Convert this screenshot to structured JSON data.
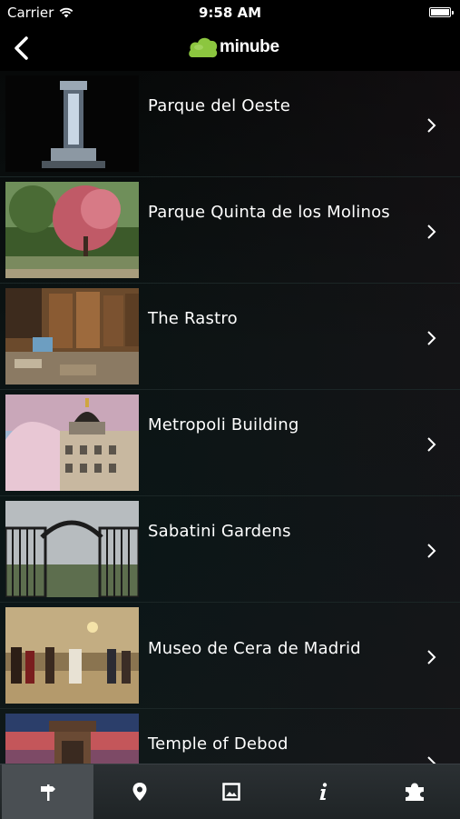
{
  "status_bar": {
    "carrier": "Carrier",
    "time": "9:58 AM"
  },
  "nav": {
    "logo_text": "minube"
  },
  "places": [
    {
      "title": "Parque del Oeste"
    },
    {
      "title": "Parque Quinta de los Molinos"
    },
    {
      "title": "The Rastro"
    },
    {
      "title": "Metropoli Building"
    },
    {
      "title": "Sabatini Gardens"
    },
    {
      "title": "Museo de Cera de Madrid"
    },
    {
      "title": "Temple of Debod"
    }
  ],
  "tabs": [
    {
      "icon": "signpost-icon",
      "active": true
    },
    {
      "icon": "map-pin-icon",
      "active": false
    },
    {
      "icon": "photo-icon",
      "active": false
    },
    {
      "icon": "info-icon",
      "active": false
    },
    {
      "icon": "puzzle-icon",
      "active": false
    }
  ],
  "colors": {
    "logo_green": "#8cc63f",
    "tab_active": "#4a4f53"
  }
}
